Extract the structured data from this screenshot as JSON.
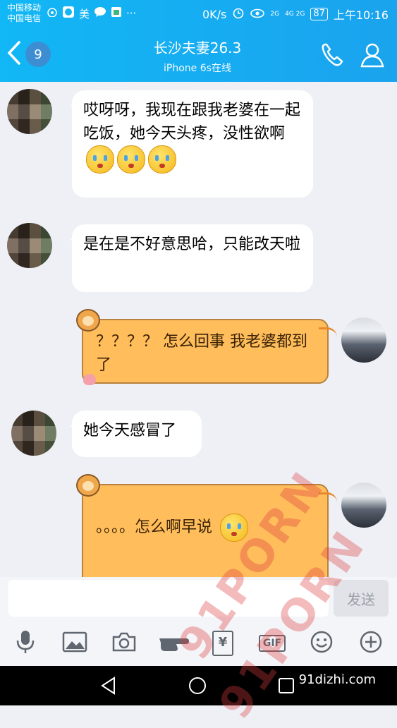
{
  "status_bar": {
    "carrier1": "中国移动",
    "carrier2": "中国电信",
    "app_badge": "美",
    "more": "···",
    "net_speed": "0K/s",
    "signal1": "2G",
    "signal2": "4G 2G",
    "battery": "87",
    "time": "上午10:16"
  },
  "header": {
    "unread_count": "9",
    "title": "长沙夫妻26.3",
    "subtitle": "iPhone 6s在线"
  },
  "messages": [
    {
      "side": "left",
      "text": "哎呀呀，我现在跟我老婆在一起吃饭，她今天头疼，没性欲啊",
      "emoji_count": 3
    },
    {
      "side": "left",
      "text": "是在是不好意思哈，只能改天啦"
    },
    {
      "side": "right",
      "text": "？？？？ 怎么回事 我老婆都到了"
    },
    {
      "side": "left",
      "text": "她今天感冒了"
    },
    {
      "side": "right",
      "text": "。。。。怎么啊早说"
    }
  ],
  "input": {
    "placeholder": "",
    "send_label": "发送"
  },
  "toolbar": {
    "gif_label": "GIF",
    "yen_label": "¥"
  },
  "watermarks": {
    "text1": "91PORN",
    "text2": "91PORN",
    "site": "91dizhi.com"
  },
  "colors": {
    "header_blue": "#12b7f5",
    "bubble_yellow": "#ffbd5c"
  }
}
